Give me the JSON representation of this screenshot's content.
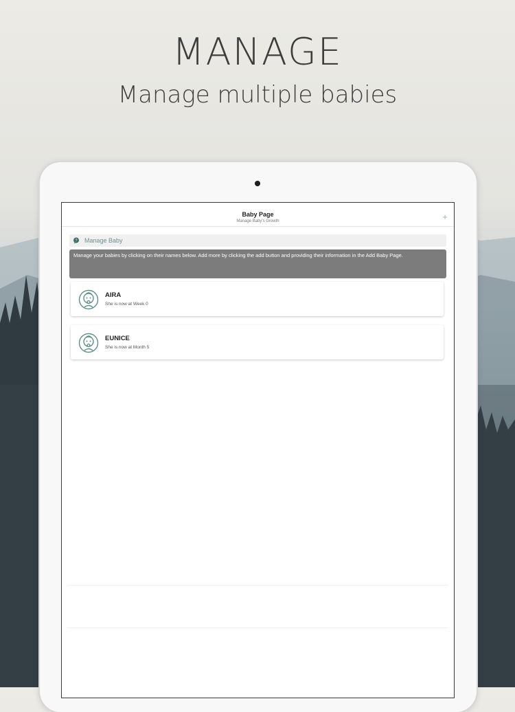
{
  "promo": {
    "headline": "MANAGE",
    "subheadline": "Manage multiple babies"
  },
  "navbar": {
    "title": "Baby Page",
    "subtitle": "Manage Baby's Growth",
    "add_label": "+"
  },
  "section": {
    "title": "Manage Baby",
    "info": "Manage your babies by clicking on their names below. Add more by clicking the add button and providing their information in the Add Baby Page."
  },
  "babies": [
    {
      "name": "AIRA",
      "status": "She is now at Week 0"
    },
    {
      "name": "EUNICE",
      "status": "She is now at Month 5"
    }
  ],
  "colors": {
    "accent": "#5f8f8a",
    "info_box": "#7c7c7c",
    "section_title": "#6f8f8f"
  },
  "icons": {
    "section": "chat-bubble-icon",
    "avatar": "baby-face-icon",
    "add": "plus-icon"
  }
}
